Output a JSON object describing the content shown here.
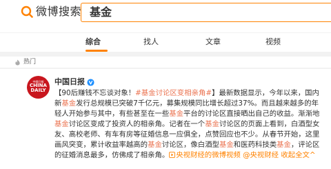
{
  "brand": {
    "logo_text": "微博搜索",
    "accent": "#ff8200"
  },
  "search": {
    "query": "基金"
  },
  "tabs": [
    {
      "label": "综合",
      "active": true
    },
    {
      "label": "找人",
      "active": false
    },
    {
      "label": "文章",
      "active": false
    },
    {
      "label": "视频",
      "active": false
    }
  ],
  "section": {
    "label": "热门"
  },
  "post": {
    "author": "中国日报",
    "avatar_text_top": "中國日報",
    "avatar_text_main": "CHINA DAILY",
    "text": {
      "s1": "【90后赚钱不忘谈对象！",
      "h1": "#基金讨论区变相亲角#",
      "s2": "】最新数据显示，今年以来，国内新",
      "k1": "基金",
      "s3": "发行总规模已突破7千亿元，募集规模同比增长超过37%。而且越来越多的年轻人开始参与其中，有些甚至在一些",
      "k2": "基金",
      "s4": "平台的讨论区直接晒出自己的收益。渐渐地",
      "k3": "基金",
      "s5": "讨论区变成了投资人的相亲角。记者在一个",
      "k4": "基金",
      "s6": "讨论区的页面上看到，白酒型女友、高校老师、有车有房等征婚信息一应俱全，点赞回应也不少。从春节开始，这里画风突变，累计收益率越高的",
      "k5": "基金",
      "s7": "讨论区，像白酒型",
      "k6": "基金",
      "s8": "和医药科技类",
      "k7": "基金",
      "s9": "，评论区的征婚消息最多，仿佛成了相亲角。",
      "l1": "央视财经的微博视频",
      "s10": " ",
      "l2": "@央视财经",
      "s11": " ",
      "l3": "收起全文",
      "l4": "^"
    }
  }
}
